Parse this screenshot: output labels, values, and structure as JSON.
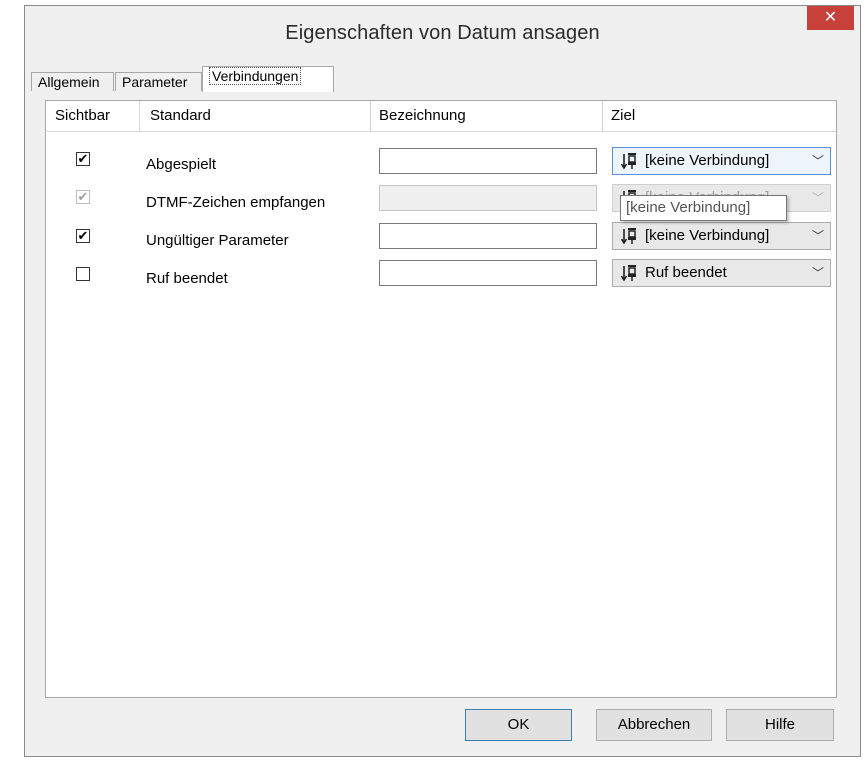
{
  "window": {
    "title": "Eigenschaften von Datum ansagen",
    "close_glyph": "✕"
  },
  "tabs": [
    {
      "label": "Allgemein",
      "active": false
    },
    {
      "label": "Parameter",
      "active": false
    },
    {
      "label": "Verbindungen",
      "active": true
    }
  ],
  "table": {
    "columns": [
      "Sichtbar",
      "Standard",
      "Bezeichnung",
      "Ziel"
    ],
    "rows": [
      {
        "visible": true,
        "visible_enabled": true,
        "standard": "Abgespielt",
        "bezeichnung": "",
        "bezeichnung_enabled": true,
        "ziel": "[keine Verbindung]",
        "ziel_enabled": true
      },
      {
        "visible": true,
        "visible_enabled": false,
        "standard": "DTMF-Zeichen empfangen",
        "bezeichnung": "",
        "bezeichnung_enabled": false,
        "ziel": "[keine Verbindung]",
        "ziel_enabled": false
      },
      {
        "visible": true,
        "visible_enabled": true,
        "standard": "Ungültiger Parameter",
        "bezeichnung": "",
        "bezeichnung_enabled": true,
        "ziel": "[keine Verbindung]",
        "ziel_enabled": true
      },
      {
        "visible": false,
        "visible_enabled": true,
        "standard": "Ruf beendet",
        "bezeichnung": "",
        "bezeichnung_enabled": true,
        "ziel": "Ruf beendet",
        "ziel_enabled": true
      }
    ]
  },
  "tooltip": {
    "text": "[keine Verbindung]"
  },
  "buttons": {
    "ok": "OK",
    "cancel": "Abbrechen",
    "help": "Hilfe"
  },
  "icons": {
    "target": "connection-target-icon",
    "dropdown": "chevron-down-icon",
    "check": "checkmark-icon"
  },
  "colors": {
    "close_red": "#c7403a",
    "focus_blue": "#5a8fd6",
    "default_button_border": "#3c7fb1"
  }
}
